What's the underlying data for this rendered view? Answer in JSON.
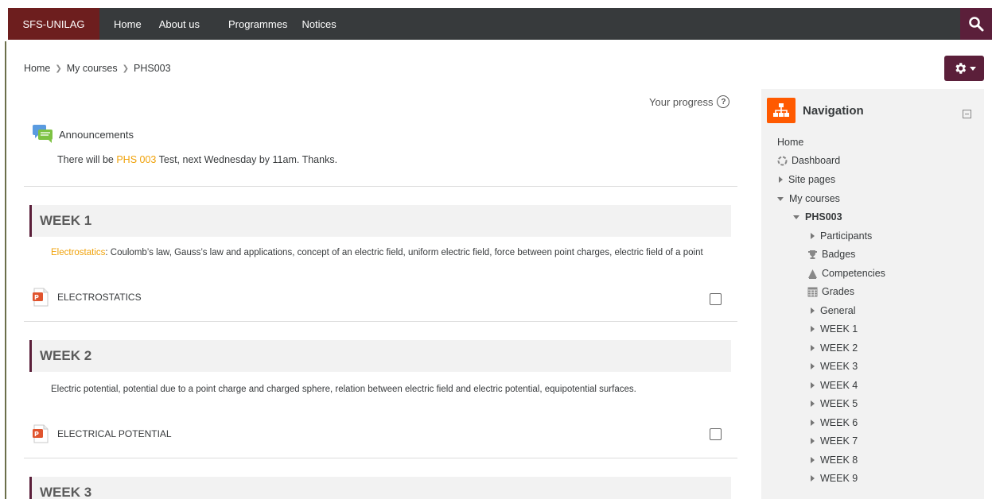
{
  "navbar": {
    "brand": "SFS-UNILAG",
    "links": [
      "Home",
      "About us",
      "Programmes",
      "Notices"
    ]
  },
  "breadcrumb": [
    "Home",
    "My courses",
    "PHS003"
  ],
  "progress_label": "Your progress",
  "announcement": {
    "title": "Announcements",
    "text_before": "There will be ",
    "highlight": "PHS 003",
    "text_after": " Test, next Wednesday by 11am. Thanks."
  },
  "weeks": [
    {
      "title": "WEEK 1",
      "summary_highlight": "Electrostatics",
      "summary_text": ": Coulomb’s law, Gauss’s law and applications, concept of an electric field, uniform electric field, force between point charges, electric field of a point",
      "activity": "ELECTROSTATICS"
    },
    {
      "title": "WEEK 2",
      "summary_highlight": "",
      "summary_text": "Electric potential, potential due to a point charge and charged sphere, relation between electric field and electric potential, equipotential surfaces.",
      "activity": "ELECTRICAL POTENTIAL"
    },
    {
      "title": "WEEK 3"
    }
  ],
  "navigation": {
    "title": "Navigation",
    "items": {
      "home": "Home",
      "dashboard": "Dashboard",
      "site_pages": "Site pages",
      "my_courses": "My courses",
      "course": "PHS003",
      "participants": "Participants",
      "badges": "Badges",
      "competencies": "Competencies",
      "grades": "Grades",
      "general": "General",
      "weeks": [
        "WEEK 1",
        "WEEK 2",
        "WEEK 3",
        "WEEK 4",
        "WEEK 5",
        "WEEK 6",
        "WEEK 7",
        "WEEK 8",
        "WEEK 9"
      ]
    }
  },
  "colors": {
    "navbar": "#373a3c",
    "brand": "#6d1e1e",
    "accent_button": "#5b1f3a",
    "highlight": "#f0a20a",
    "nav_icon": "#ff5a00"
  }
}
